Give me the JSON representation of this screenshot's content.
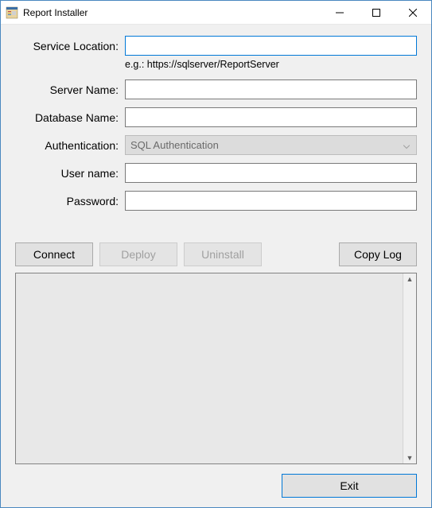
{
  "window": {
    "title": "Report Installer"
  },
  "form": {
    "service_location": {
      "label": "Service Location:",
      "value": "",
      "hint": "e.g.: https://sqlserver/ReportServer"
    },
    "server_name": {
      "label": "Server Name:",
      "value": ""
    },
    "database_name": {
      "label": "Database Name:",
      "value": ""
    },
    "authentication": {
      "label": "Authentication:",
      "value": "SQL Authentication"
    },
    "user_name": {
      "label": "User name:",
      "value": ""
    },
    "password": {
      "label": "Password:",
      "value": ""
    }
  },
  "buttons": {
    "connect": "Connect",
    "deploy": "Deploy",
    "uninstall": "Uninstall",
    "copy_log": "Copy Log",
    "exit": "Exit"
  },
  "log": {
    "content": ""
  }
}
